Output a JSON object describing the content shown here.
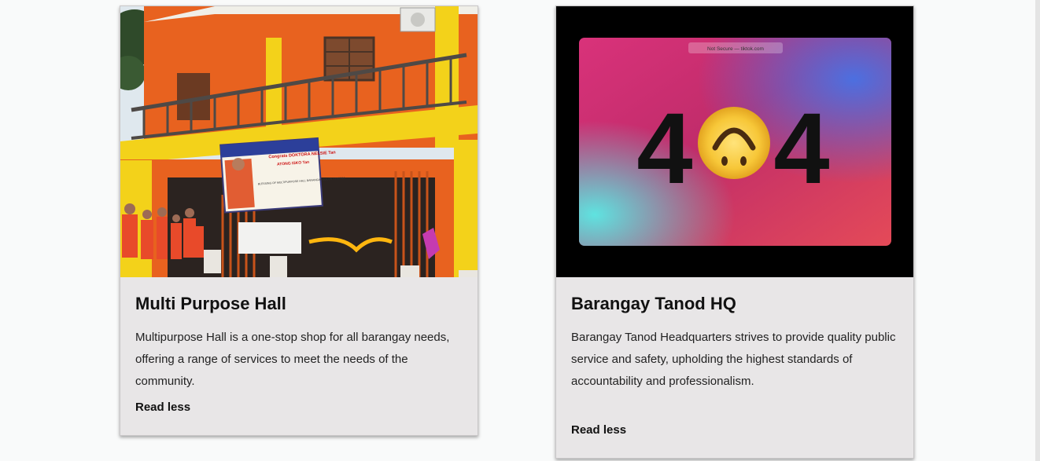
{
  "cards": [
    {
      "title": "Multi Purpose Hall",
      "description": "Multipurpose Hall is a one-stop shop for all barangay needs, offering a range of services to meet the needs of the community.",
      "link_label": "Read less",
      "image": {
        "banner_title": "Congrats DOKTORA NELSIE Tan",
        "banner_subtitle": "ATONG ISKO Tan",
        "banner_body": "BLESSING OF MULTIPURPOSE HALL BARANGAY COLON NIVERSA"
      }
    },
    {
      "title": "Barangay Tanod HQ",
      "description": "Barangay Tanod Headquarters strives to provide quality public service and safety, upholding the highest standards of accountability and professionalism.",
      "link_label": "Read less",
      "image": {
        "address_bar": "Not Secure — tiktok.com",
        "left_digit": "4",
        "right_digit": "4"
      }
    }
  ],
  "colors": {
    "page_bg": "#f9fafa",
    "card_bg": "#e8e6e7",
    "building_orange": "#e8621f",
    "building_yellow": "#f3d21a"
  }
}
